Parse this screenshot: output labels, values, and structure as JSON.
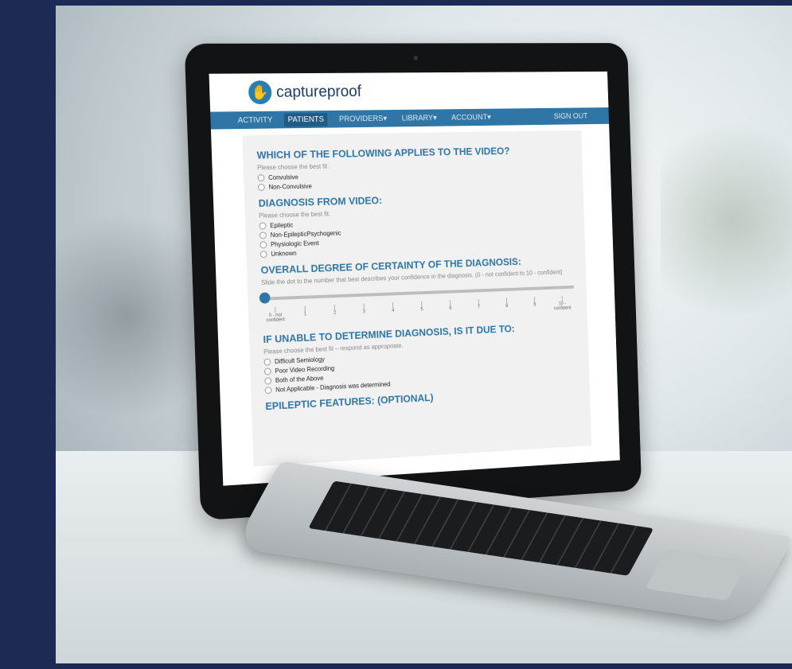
{
  "app": {
    "brand": "captureproof",
    "nav": [
      "ACTIVITY",
      "PATIENTS",
      "PROVIDERS▾",
      "LIBRARY▾",
      "ACCOUNT▾"
    ],
    "active_nav": "PATIENTS",
    "sign_out": "SIGN OUT"
  },
  "questions": {
    "q1": {
      "title": "WHICH OF THE FOLLOWING APPLIES TO THE VIDEO?",
      "hint": "Please choose the best fit.",
      "options": [
        "Convulsive",
        "Non-Convulsive"
      ]
    },
    "q2": {
      "title": "DIAGNOSIS FROM VIDEO:",
      "hint": "Please choose the best fit.",
      "options": [
        "Epileptic",
        "Non-EpilepticPsychogenic",
        "Physiologic Event",
        "Unknown"
      ]
    },
    "q3": {
      "title": "OVERALL DEGREE OF CERTAINTY OF THE DIAGNOSIS:",
      "hint": "Slide the dot to the number that best describes your confidence in the diagnosis. (0 - not confident to 10 - confident)",
      "ticks": [
        "0 - not confident",
        "1",
        "2",
        "3",
        "4",
        "5",
        "6",
        "7",
        "8",
        "9",
        "10 - confident"
      ],
      "slider_value": 0
    },
    "q4": {
      "title": "IF UNABLE TO DETERMINE DIAGNOSIS, IS IT DUE TO:",
      "hint": "Please choose the best fit – respond as appropriate.",
      "options": [
        "Difficult Semiology",
        "Poor Video Recording",
        "Both of the Above",
        "Not Applicable - Diagnosis was determined"
      ]
    },
    "q5": {
      "title": "EPILEPTIC FEATURES: (OPTIONAL)"
    }
  },
  "colors": {
    "frame": "#1e2a56",
    "accent": "#2f76a6",
    "panel": "#f1f1f1"
  }
}
